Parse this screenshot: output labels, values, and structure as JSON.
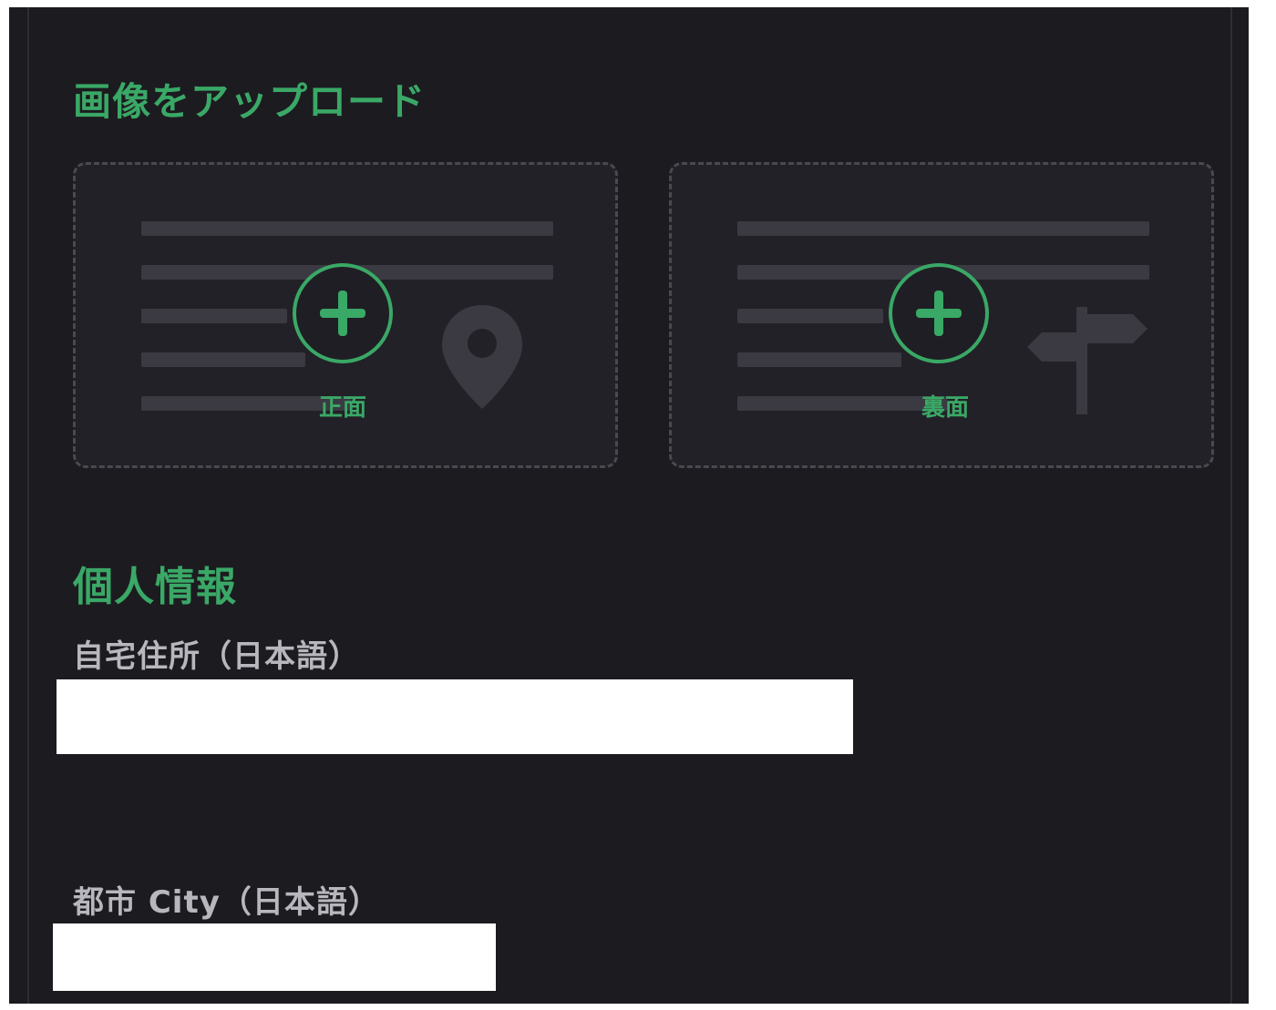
{
  "upload_section": {
    "title": "画像をアップロード",
    "front": {
      "label": "正面",
      "icon": "map-pin-icon"
    },
    "back": {
      "label": "裏面",
      "icon": "signpost-icon"
    }
  },
  "personal_section": {
    "title": "個人情報",
    "fields": [
      {
        "label": "自宅住所（日本語）",
        "value": ""
      },
      {
        "label": "都市 City（日本語）",
        "value": ""
      }
    ]
  },
  "colors": {
    "accent": "#3aa866",
    "background": "#1c1b20",
    "card": "#222127",
    "label": "#b8b7bd"
  }
}
